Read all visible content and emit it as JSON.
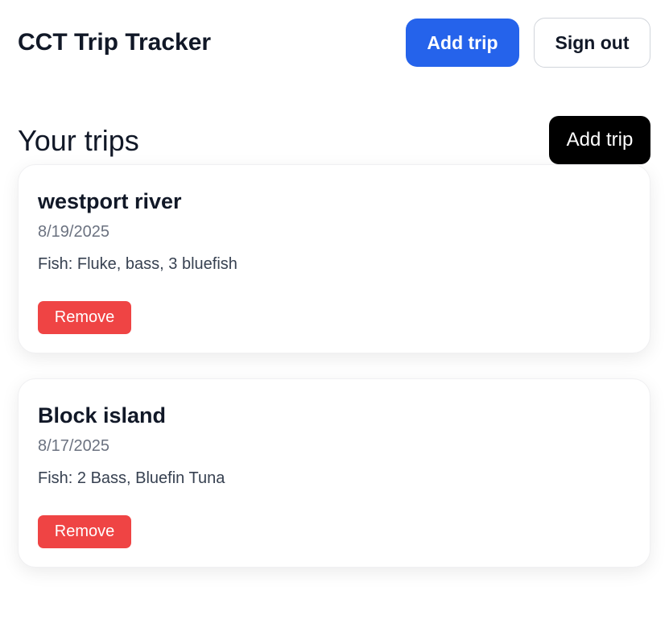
{
  "header": {
    "app_title": "CCT Trip Tracker",
    "add_trip_label": "Add trip",
    "sign_out_label": "Sign out"
  },
  "main": {
    "section_title": "Your trips",
    "add_trip_label": "Add trip",
    "trips": [
      {
        "name": "westport river",
        "date": "8/19/2025",
        "fish": "Fish: Fluke, bass, 3 bluefish",
        "remove_label": "Remove"
      },
      {
        "name": "Block island",
        "date": "8/17/2025",
        "fish": "Fish: 2 Bass, Bluefin Tuna",
        "remove_label": "Remove"
      }
    ]
  },
  "colors": {
    "primary": "#2563eb",
    "danger": "#ef4444",
    "dark_button": "#000000",
    "text": "#111827",
    "muted": "#6b7280"
  }
}
